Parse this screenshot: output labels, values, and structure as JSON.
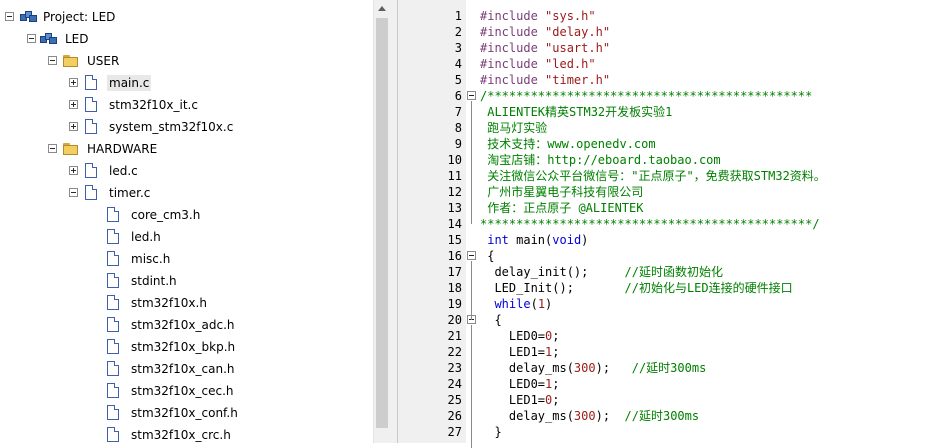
{
  "project_tree": {
    "project_label": "Project: LED",
    "target_label": "LED",
    "groups": [
      {
        "label": "USER",
        "files": [
          {
            "label": "main.c"
          },
          {
            "label": "stm32f10x_it.c"
          },
          {
            "label": "system_stm32f10x.c"
          }
        ]
      },
      {
        "label": "HARDWARE",
        "files": [
          {
            "label": "led.c"
          },
          {
            "label": "timer.c"
          }
        ]
      }
    ],
    "timer_headers": [
      "core_cm3.h",
      "led.h",
      "misc.h",
      "stdint.h",
      "stm32f10x.h",
      "stm32f10x_adc.h",
      "stm32f10x_bkp.h",
      "stm32f10x_can.h",
      "stm32f10x_cec.h",
      "stm32f10x_conf.h",
      "stm32f10x_crc.h"
    ]
  },
  "editor": {
    "lines": [
      {
        "n": "1",
        "segs": [
          [
            "pp",
            "#include "
          ],
          [
            "str",
            "\"sys.h\""
          ]
        ]
      },
      {
        "n": "2",
        "segs": [
          [
            "pp",
            "#include "
          ],
          [
            "str",
            "\"delay.h\""
          ]
        ]
      },
      {
        "n": "3",
        "segs": [
          [
            "pp",
            "#include "
          ],
          [
            "str",
            "\"usart.h\""
          ]
        ]
      },
      {
        "n": "4",
        "segs": [
          [
            "pp",
            "#include "
          ],
          [
            "str",
            "\"led.h\""
          ]
        ]
      },
      {
        "n": "5",
        "segs": [
          [
            "pp",
            "#include "
          ],
          [
            "str",
            "\"timer.h\""
          ]
        ]
      },
      {
        "n": "6",
        "segs": [
          [
            "cmt",
            "/*********************************************"
          ]
        ]
      },
      {
        "n": "7",
        "segs": [
          [
            "cmt",
            " ALIENTEK精英STM32开发板实验1"
          ]
        ]
      },
      {
        "n": "8",
        "segs": [
          [
            "cmt",
            " 跑马灯实验"
          ]
        ]
      },
      {
        "n": "9",
        "segs": [
          [
            "cmt",
            " 技术支持：www.openedv.com"
          ]
        ]
      },
      {
        "n": "10",
        "segs": [
          [
            "cmt",
            " 淘宝店铺：http://eboard.taobao.com"
          ]
        ]
      },
      {
        "n": "11",
        "segs": [
          [
            "cmt",
            " 关注微信公众平台微信号：\"正点原子\"，免费获取STM32资料。"
          ]
        ]
      },
      {
        "n": "12",
        "segs": [
          [
            "cmt",
            " 广州市星翼电子科技有限公司"
          ]
        ]
      },
      {
        "n": "13",
        "segs": [
          [
            "cmt",
            " 作者：正点原子 @ALIENTEK"
          ]
        ]
      },
      {
        "n": "14",
        "segs": [
          [
            "cmt",
            "**********************************************/"
          ]
        ]
      },
      {
        "n": "15",
        "segs": [
          [
            "kw",
            " int"
          ],
          [
            "plain",
            " main("
          ],
          [
            "kw",
            "void"
          ],
          [
            "plain",
            ")"
          ]
        ]
      },
      {
        "n": "16",
        "segs": [
          [
            "plain",
            " {"
          ]
        ]
      },
      {
        "n": "17",
        "segs": [
          [
            "plain",
            "  delay_init();     "
          ],
          [
            "cmt",
            "//延时函数初始化"
          ]
        ]
      },
      {
        "n": "18",
        "segs": [
          [
            "plain",
            "  LED_Init();       "
          ],
          [
            "cmt",
            "//初始化与LED连接的硬件接口"
          ]
        ]
      },
      {
        "n": "19",
        "segs": [
          [
            "kw",
            "  while"
          ],
          [
            "plain",
            "("
          ],
          [
            "num",
            "1"
          ],
          [
            "plain",
            ")"
          ]
        ]
      },
      {
        "n": "20",
        "segs": [
          [
            "plain",
            "  {"
          ]
        ]
      },
      {
        "n": "21",
        "segs": [
          [
            "plain",
            "    LED0="
          ],
          [
            "num",
            "0"
          ],
          [
            "plain",
            ";"
          ]
        ]
      },
      {
        "n": "22",
        "segs": [
          [
            "plain",
            "    LED1="
          ],
          [
            "num",
            "1"
          ],
          [
            "plain",
            ";"
          ]
        ]
      },
      {
        "n": "23",
        "segs": [
          [
            "plain",
            "    delay_ms("
          ],
          [
            "num",
            "300"
          ],
          [
            "plain",
            ");   "
          ],
          [
            "cmt",
            "//延时300ms"
          ]
        ]
      },
      {
        "n": "24",
        "segs": [
          [
            "plain",
            "    LED0="
          ],
          [
            "num",
            "1"
          ],
          [
            "plain",
            ";"
          ]
        ]
      },
      {
        "n": "25",
        "segs": [
          [
            "plain",
            "    LED1="
          ],
          [
            "num",
            "0"
          ],
          [
            "plain",
            ";"
          ]
        ]
      },
      {
        "n": "26",
        "segs": [
          [
            "plain",
            "    delay_ms("
          ],
          [
            "num",
            "300"
          ],
          [
            "plain",
            ");  "
          ],
          [
            "cmt",
            "//延时300ms"
          ]
        ]
      },
      {
        "n": "27",
        "segs": [
          [
            "plain",
            "  }"
          ]
        ]
      }
    ],
    "fold_markers": [
      "6",
      "16",
      "20"
    ]
  }
}
